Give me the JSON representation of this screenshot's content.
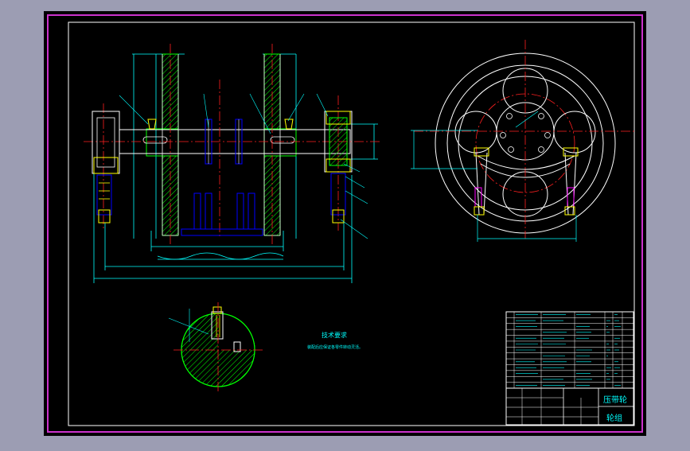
{
  "drawing": {
    "tech_req_title": "技术要求",
    "tech_req_text": "装配后应保证各零件转动灵活。",
    "title_block": {
      "part_name": "压带轮",
      "sub_name": "轮组"
    }
  },
  "colors": {
    "background": "#000000",
    "border": "#ffffff",
    "outer_frame": "#cc33cc",
    "dimension": "#00ffff",
    "center_line": "#ff2020",
    "hatch": "#00ff00",
    "part_line": "#ffff00",
    "section_line": "#0000ff"
  }
}
